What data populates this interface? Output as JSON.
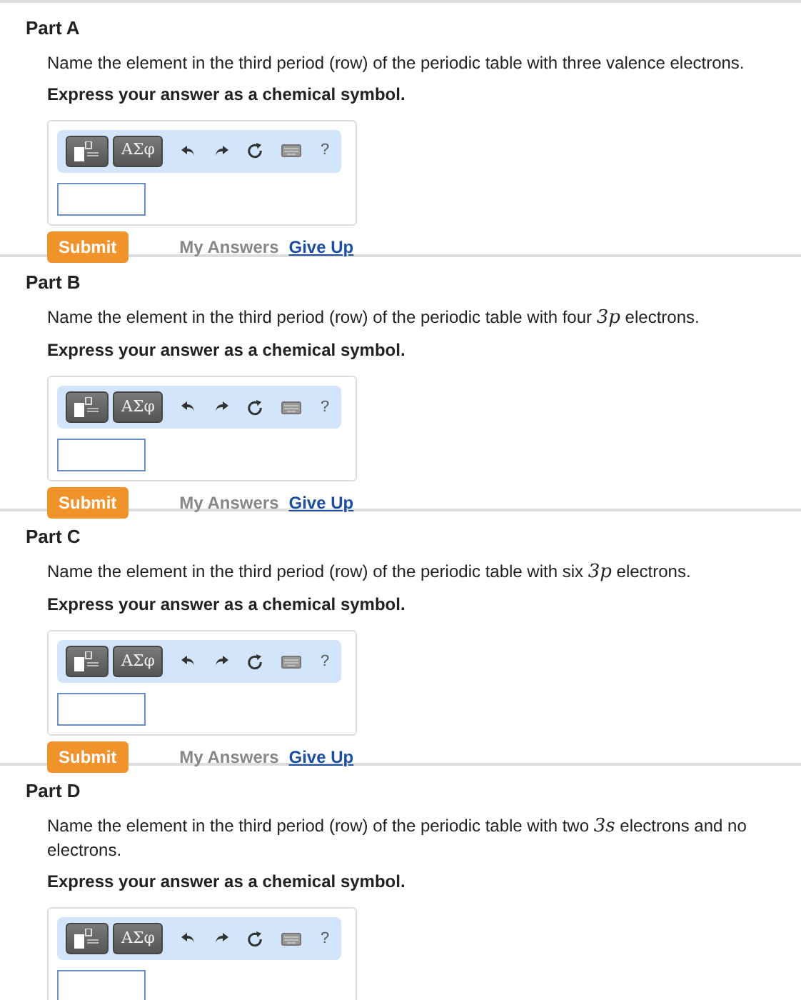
{
  "parts": [
    {
      "title": "Part A",
      "question": [
        {
          "kind": "text",
          "text": "Name the element in the third period (row) of the periodic table with three valence electrons."
        }
      ],
      "instruction": "Express your answer as a chemical symbol.",
      "toolbar": {
        "symbols": "ΑΣφ",
        "help": "?"
      },
      "submit": {
        "label": "Submit",
        "my_answers": "My Answers",
        "give_up": "Give Up"
      }
    },
    {
      "title": "Part B",
      "question": [
        {
          "kind": "text",
          "text": "Name the element in the third period (row) of the periodic table with four "
        },
        {
          "kind": "math",
          "text": "3p"
        },
        {
          "kind": "text",
          "text": " electrons."
        }
      ],
      "instruction": "Express your answer as a chemical symbol.",
      "toolbar": {
        "symbols": "ΑΣφ",
        "help": "?"
      },
      "submit": {
        "label": "Submit",
        "my_answers": "My Answers",
        "give_up": "Give Up"
      }
    },
    {
      "title": "Part C",
      "question": [
        {
          "kind": "text",
          "text": "Name the element in the third period (row) of the periodic table with six "
        },
        {
          "kind": "math",
          "text": "3p"
        },
        {
          "kind": "text",
          "text": " electrons."
        }
      ],
      "instruction": "Express your answer as a chemical symbol.",
      "toolbar": {
        "symbols": "ΑΣφ",
        "help": "?"
      },
      "submit": {
        "label": "Submit",
        "my_answers": "My Answers",
        "give_up": "Give Up"
      }
    },
    {
      "title": "Part D",
      "question": [
        {
          "kind": "text",
          "text": "Name the element in the third period (row) of the periodic table with two "
        },
        {
          "kind": "math",
          "text": "3s"
        },
        {
          "kind": "text",
          "text": " electrons and no electrons."
        }
      ],
      "instruction": "Express your answer as a chemical symbol.",
      "toolbar": {
        "symbols": "ΑΣφ",
        "help": "?"
      }
    }
  ]
}
